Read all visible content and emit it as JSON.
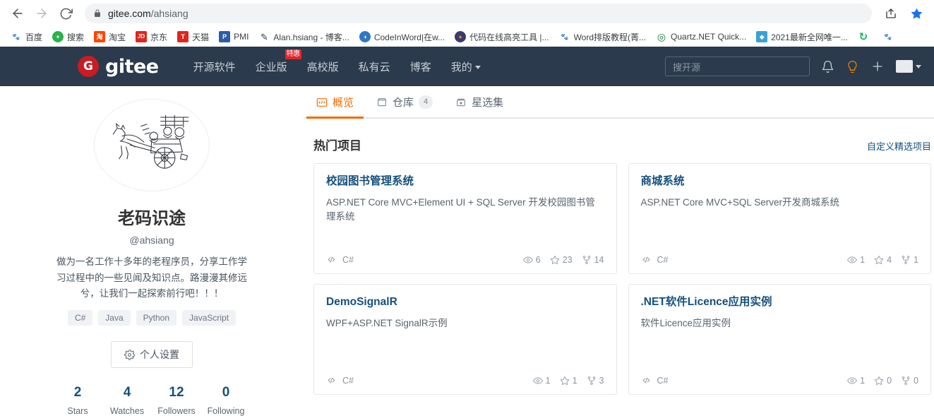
{
  "browser": {
    "back_label": "Back",
    "forward_label": "Forward",
    "reload_label": "Reload",
    "lock_icon": "lock-icon",
    "url_domain": "gitee.com",
    "url_path": "/ahsiang",
    "share_label": "Share",
    "bookmark_star_label": "Bookmark this tab",
    "bookmarks": [
      {
        "label": "百度",
        "icon": "baidu-icon",
        "color": "#2932e1",
        "glyph": "百",
        "bg": "#ffffff"
      },
      {
        "label": "搜索",
        "icon": "search-plus-icon",
        "color": "#ffffff",
        "glyph": "+",
        "bg": "#2bb14b"
      },
      {
        "label": "淘宝",
        "icon": "taobao-icon",
        "color": "#ffffff",
        "glyph": "淘",
        "bg": "#ff4400"
      },
      {
        "label": "京东",
        "icon": "jd-icon",
        "color": "#ffffff",
        "glyph": "JD",
        "bg": "#e1251b"
      },
      {
        "label": "天猫",
        "icon": "tmall-icon",
        "color": "#ffffff",
        "glyph": "T",
        "bg": "#e1251b"
      },
      {
        "label": "PMI",
        "icon": "pmi-icon",
        "color": "#ffffff",
        "glyph": "P",
        "bg": "#2a5caa"
      },
      {
        "label": "Alan.hsiang - 博客...",
        "icon": "cnblogs-icon",
        "color": "#2b3a4d",
        "glyph": "✈",
        "bg": "#ffffff"
      },
      {
        "label": "CodeInWord|在w...",
        "icon": "globe-icon",
        "color": "#ffffff",
        "glyph": "◑",
        "bg": "#2f77c4"
      },
      {
        "label": "代码在线高亮工具 |...",
        "icon": "highlight-icon",
        "color": "#ffffff",
        "glyph": "●",
        "bg": "#3a3a6e"
      },
      {
        "label": "Word排版教程(菁...",
        "icon": "baidu-icon",
        "color": "#2932e1",
        "glyph": "百",
        "bg": "#ffffff"
      },
      {
        "label": "Quartz.NET Quick...",
        "icon": "quartz-icon",
        "color": "#ffffff",
        "glyph": "Q",
        "bg": "#1b7a3d"
      },
      {
        "label": "2021最新全网唯一...",
        "icon": "box-icon",
        "color": "#ffffff",
        "glyph": "◆",
        "bg": "#3aa0d8"
      },
      {
        "label": "",
        "icon": "recycle-icon",
        "color": "#ffffff",
        "glyph": "↻",
        "bg": "#18b566"
      }
    ]
  },
  "header": {
    "logo_mark": "G",
    "logo_text": "gitee",
    "nav": [
      {
        "label": "开源软件",
        "badge": ""
      },
      {
        "label": "企业版",
        "badge": "特惠"
      },
      {
        "label": "高校版",
        "badge": ""
      },
      {
        "label": "私有云",
        "badge": ""
      },
      {
        "label": "博客",
        "badge": ""
      },
      {
        "label": "我的",
        "badge": "",
        "caret": true
      }
    ],
    "search_placeholder": "搜开源",
    "notification_icon": "bell-icon",
    "idea_icon": "lightbulb-icon",
    "add_icon": "plus-icon",
    "user_avatar_icon": "user-avatar",
    "accent_color": "#c71d23",
    "background_color": "#2b3a4d"
  },
  "profile": {
    "avatar_icon": "horse-cart-avatar",
    "display_name": "老码识途",
    "login": "@ahsiang",
    "bio": "做为一名工作十多年的老程序员，分享工作学习过程中的一些见闻及知识点。路漫漫其修远兮，让我们一起探索前行吧！！！",
    "tags": [
      "C#",
      "Java",
      "Python",
      "JavaScript"
    ],
    "settings_button": {
      "label": "个人设置",
      "icon": "gear-icon"
    },
    "stats": [
      {
        "value": "2",
        "label": "Stars"
      },
      {
        "value": "4",
        "label": "Watches"
      },
      {
        "value": "12",
        "label": "Followers"
      },
      {
        "value": "0",
        "label": "Following"
      }
    ]
  },
  "main": {
    "tabs": [
      {
        "label": "概览",
        "icon": "code-overview-icon",
        "count": "",
        "active": true
      },
      {
        "label": "仓库",
        "icon": "repo-icon",
        "count": "4",
        "active": false
      },
      {
        "label": "星选集",
        "icon": "star-box-icon",
        "count": "",
        "active": false
      }
    ],
    "section_title": "热门项目",
    "section_link": "自定义精选项目",
    "accent_color": "#f56a00",
    "link_color": "#14507d",
    "cards": [
      {
        "title": "校园图书管理系统",
        "description": "ASP.NET Core MVC+Element UI + SQL Server 开发校园图书管理系统",
        "language": "C#",
        "watches": "6",
        "stars": "23",
        "forks": "14"
      },
      {
        "title": "商城系统",
        "description": "ASP.NET Core MVC+SQL Server开发商城系统",
        "language": "C#",
        "watches": "1",
        "stars": "4",
        "forks": "1"
      },
      {
        "title": "DemoSignalR",
        "description": "WPF+ASP.NET SignalR示例",
        "language": "C#",
        "watches": "1",
        "stars": "1",
        "forks": "3"
      },
      {
        "title": ".NET软件Licence应用实例",
        "description": "软件Licence应用实例",
        "language": "C#",
        "watches": "1",
        "stars": "0",
        "forks": "0"
      }
    ]
  }
}
